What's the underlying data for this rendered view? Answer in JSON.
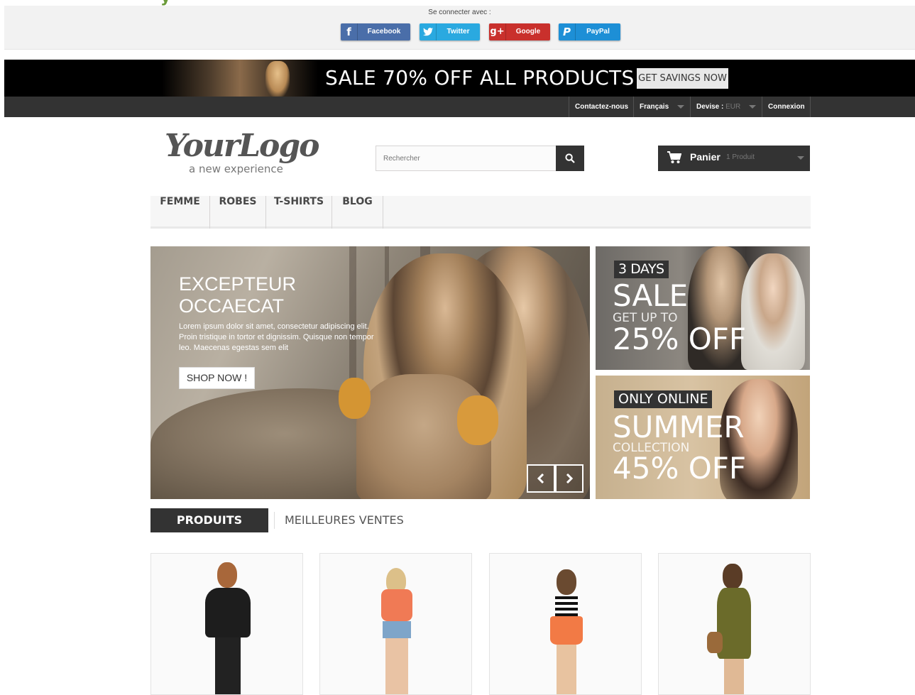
{
  "social": {
    "label": "Se connecter avec :",
    "buttons": [
      {
        "label": "Facebook",
        "icon": "facebook-icon",
        "glyph": "f",
        "color": "#4a6ea9"
      },
      {
        "label": "Twitter",
        "icon": "twitter-icon",
        "glyph": "t",
        "color": "#2aa9e0"
      },
      {
        "label": "Google",
        "icon": "google-plus-icon",
        "glyph": "g+",
        "color": "#c9302c"
      },
      {
        "label": "PayPal",
        "icon": "paypal-icon",
        "glyph": "P",
        "color": "#1d8fd6"
      }
    ]
  },
  "promo": {
    "text": "SALE 70% OFF ALL PRODUCTS",
    "button": "GET SAVINGS NOW"
  },
  "usernav": {
    "contact": "Contactez-nous",
    "language": "Français",
    "currency_label": "Devise :",
    "currency_value": "EUR",
    "login": "Connexion"
  },
  "header": {
    "logo_script": "YourLogo",
    "logo_tagline": "a new experience",
    "search_placeholder": "Rechercher",
    "cart_label": "Panier",
    "cart_count": "1 Produit"
  },
  "menu": [
    "FEMME",
    "ROBES",
    "T-SHIRTS",
    "BLOG"
  ],
  "slider": {
    "title_line1": "EXCEPTEUR",
    "title_line2": "OCCAECAT",
    "description": "Lorem ipsum dolor sit amet, consectetur adipiscing elit. Proin tristique in tortor et dignissim. Quisque non tempor leo. Maecenas egestas sem elit",
    "button": "SHOP NOW !"
  },
  "banners": [
    {
      "tag": "3 DAYS",
      "big": "SALE",
      "small": "GET UP TO",
      "pct": "25% OFF"
    },
    {
      "tag": "ONLY ONLINE",
      "big": "SUMMER",
      "small": "COLLECTION",
      "pct": "45% OFF"
    }
  ],
  "tabs": {
    "active": "PRODUITS PHARES",
    "inactive": "MEILLEURES VENTES"
  },
  "colors": {
    "dark": "#333333",
    "menu_bg": "#f6f6f6"
  }
}
